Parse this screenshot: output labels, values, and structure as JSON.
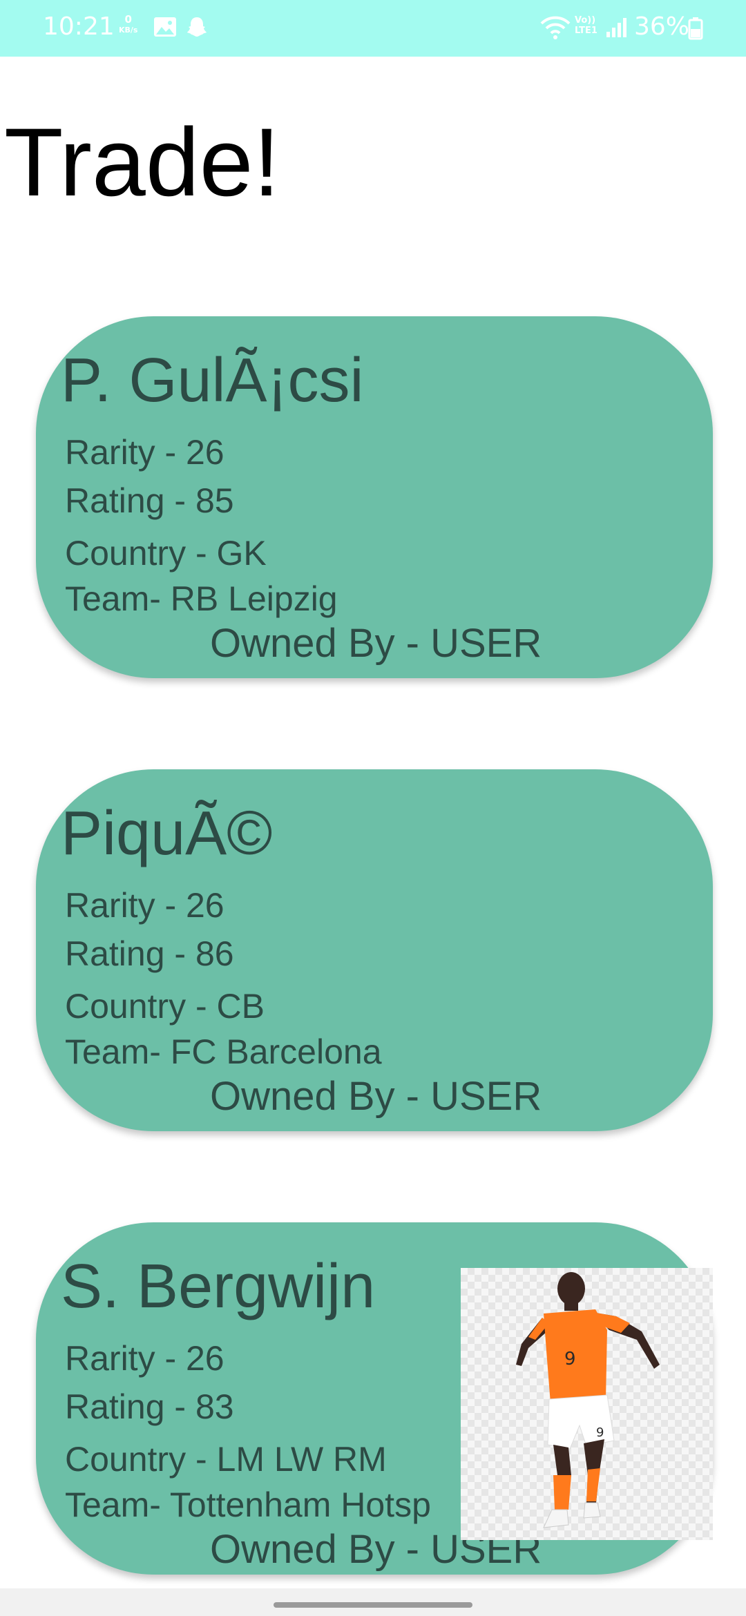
{
  "status_bar": {
    "time": "10:21",
    "net_speed_value": "0",
    "net_speed_unit": "KB/s",
    "volte_line1": "Vo))",
    "volte_line2": "LTE1",
    "battery_percent": "36%",
    "icons": [
      "gallery-icon",
      "snapchat-ghost-icon",
      "wifi-icon",
      "signal-icon",
      "battery-icon"
    ],
    "background_color": "#a3fbf0"
  },
  "page": {
    "title": "Trade!"
  },
  "colors": {
    "card_background": "#6cbfa7",
    "card_text": "#2d4b45"
  },
  "cards": [
    {
      "name": "P. GulÃ¡csi",
      "rarity": "Rarity - 26",
      "rating": "Rating - 85",
      "country": "Country - GK",
      "team": "Team- RB Leipzig",
      "owner": "Owned By - USER"
    },
    {
      "name": "PiquÃ©",
      "rarity": "Rarity - 26",
      "rating": "Rating - 86",
      "country": "Country - CB",
      "team": "Team- FC Barcelona",
      "owner": "Owned By - USER"
    },
    {
      "name": "S. Bergwijn",
      "rarity": "Rarity - 26",
      "rating": "Rating - 83",
      "country": "Country - LM LW RM",
      "team": "Team- Tottenham Hotsp",
      "owner": "Owned By - USER",
      "image": "player-photo"
    }
  ]
}
